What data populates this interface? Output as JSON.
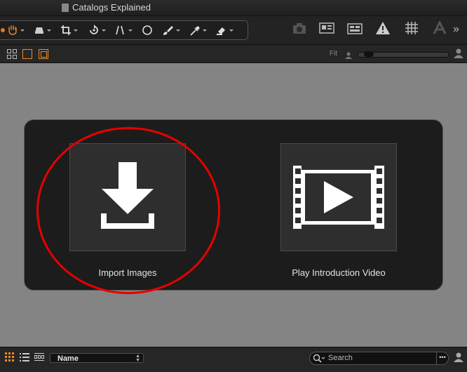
{
  "window": {
    "title": "Catalogs Explained"
  },
  "toolbar": {
    "tools": [
      "pan-icon",
      "hand-icon",
      "eraser-icon",
      "crop-icon",
      "rotate-icon",
      "straighten-icon",
      "circle-mask-icon",
      "brush-icon",
      "picker-icon",
      "stamp-icon"
    ],
    "right_tools": [
      "camera-icon",
      "browser-layout-icon",
      "compare-layout-icon",
      "warning-icon",
      "grid-icon",
      "text-overlay-icon"
    ],
    "more_label": "»"
  },
  "viewbar": {
    "fit_label": "Fit",
    "zoom_value": 0.05
  },
  "welcome": {
    "import_label": "Import Images",
    "video_label": "Play Introduction Video"
  },
  "bottombar": {
    "sort_value": "Name",
    "search_placeholder": "Search",
    "search_more": "•••"
  },
  "colors": {
    "accent": "#f08a24",
    "annotation": "#e60000"
  }
}
